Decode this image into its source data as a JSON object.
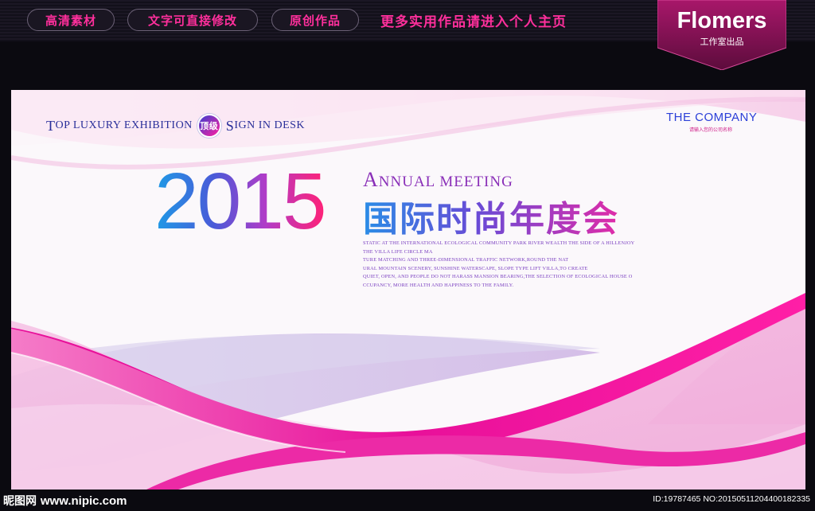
{
  "topbar": {
    "pills": [
      "高清素材",
      "文字可直接修改",
      "原创作品"
    ],
    "promo": "更多实用作品请进入个人主页",
    "badge_title": "Flomers",
    "badge_sub": "工作室出品"
  },
  "poster": {
    "tagline_t": "T",
    "tagline_1": "OP LUXURY EXHIBITION",
    "seal": "顶级",
    "tagline_s": "S",
    "tagline_2": "IGN IN DESK",
    "company": "THE COMPANY",
    "company_sub": "请输入您的公司名称",
    "year": "2015",
    "annual_a": "A",
    "annual_rest": "NNUAL MEETING",
    "cn_title": "国际时尚年度会",
    "paragraph": [
      "STATIC AT THE INTERNATIONAL ECOLOGICAL COMMUNITY PARK RIVER WEALTH THE SIDE OF A HILLENJOY",
      "THE VILLA LIFE CIRCLE MA",
      "TURE MATCHING AND THREE-DIMENSIONAL TRAFFIC NETWORK,ROUND THE NAT",
      "URAL MOUNTAIN SCENERY, SUNSHINE WATERSCAPE, SLOPE TYPE LIFT VILLA,TO CREATE",
      "QUIET, OPEN, AND PEOPLE DO NOT HARASS MANSION BEARING,THE SELECTION OF ECOLOGICAL HOUSE O",
      "CCUPANCY, MORE HEALTH AND HAPPINESS TO THE FAMILY."
    ]
  },
  "footer": {
    "logo": "昵图网",
    "site": "www.nipic.com",
    "id_text": "ID:19787465 NO:20150511204400182335"
  },
  "colors": {
    "accent_pink": "#ff2f9c",
    "magenta": "#e8109a",
    "navy": "#2a2f9a"
  }
}
